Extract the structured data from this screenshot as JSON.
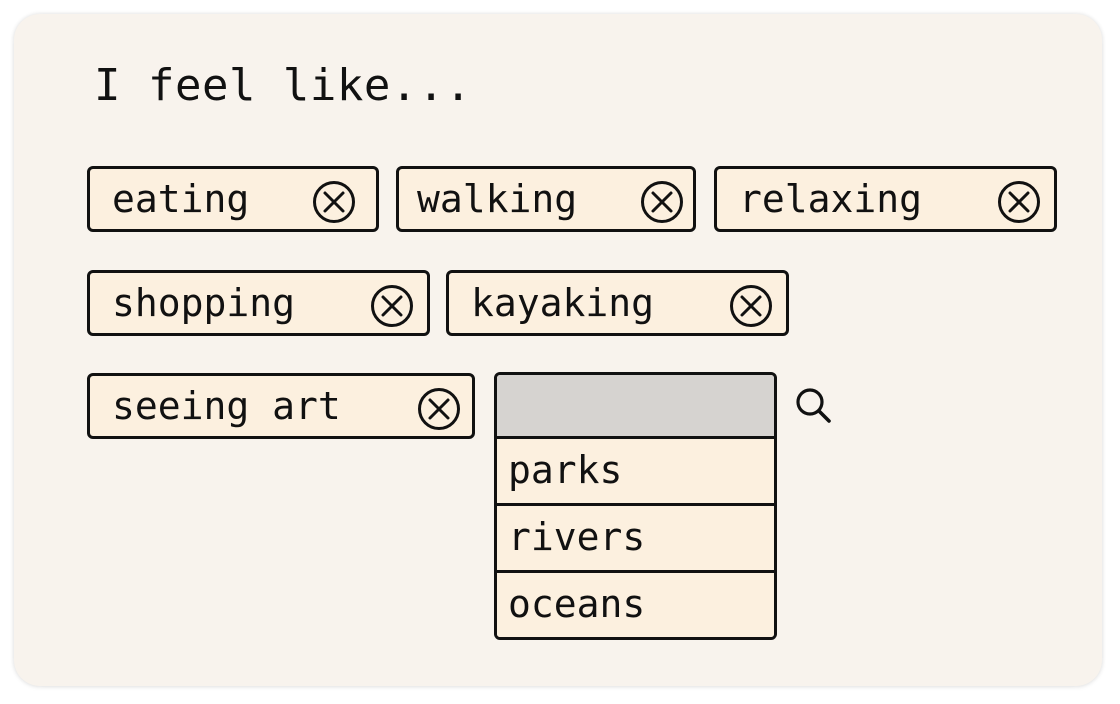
{
  "heading": "I feel like...",
  "chips": [
    {
      "label": "eating",
      "remove_icon": "circle-x-icon"
    },
    {
      "label": "walking",
      "remove_icon": "circle-x-icon"
    },
    {
      "label": "relaxing",
      "remove_icon": "circle-x-icon"
    },
    {
      "label": "shopping",
      "remove_icon": "circle-x-icon"
    },
    {
      "label": "kayaking",
      "remove_icon": "circle-x-icon"
    },
    {
      "label": "seeing art",
      "remove_icon": "circle-x-icon"
    }
  ],
  "search": {
    "value": "",
    "placeholder": "",
    "icon": "search-icon",
    "options": [
      "parks",
      "rivers",
      "oceans"
    ]
  },
  "colors": {
    "card_bg": "#f8f3ed",
    "chip_bg": "#fcf0df",
    "input_bg": "#d6d3d0",
    "border": "#111111"
  }
}
